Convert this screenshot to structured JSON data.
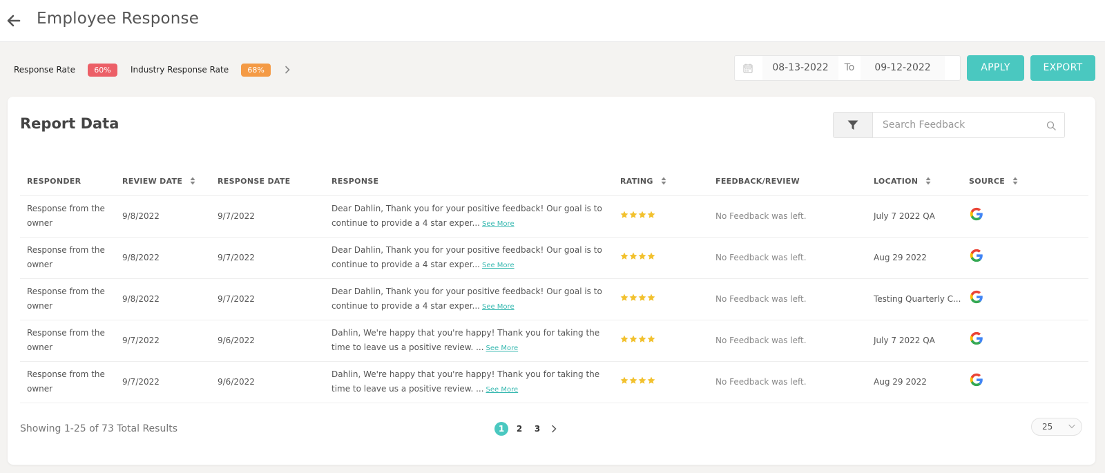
{
  "header": {
    "title": "Employee Response"
  },
  "rates": {
    "response_label": "Response Rate",
    "response_value": "60%",
    "industry_label": "Industry Response Rate",
    "industry_value": "68%"
  },
  "date_range": {
    "from": "08-13-2022",
    "to_label": "To",
    "to": "09-12-2022"
  },
  "actions": {
    "apply": "APPLY",
    "export": "EXPORT"
  },
  "report": {
    "title": "Report Data",
    "search_placeholder": "Search Feedback",
    "columns": [
      "RESPONDER",
      "REVIEW DATE",
      "RESPONSE DATE",
      "RESPONSE",
      "RATING",
      "FEEDBACK/REVIEW",
      "LOCATION",
      "SOURCE"
    ],
    "rows": [
      {
        "responder": "Response from the owner",
        "review_date": "9/8/2022",
        "response_date": "9/7/2022",
        "response": "Dear Dahlin, Thank you for your positive feedback! Our goal is to continue to provide a 4 star exper...",
        "see_more": "See More",
        "rating": 4,
        "feedback": "No Feedback was left.",
        "location": "July 7 2022 QA",
        "source": "google-icon"
      },
      {
        "responder": "Response from the owner",
        "review_date": "9/8/2022",
        "response_date": "9/7/2022",
        "response": "Dear Dahlin, Thank you for your positive feedback! Our goal is to continue to provide a 4 star exper...",
        "see_more": "See More",
        "rating": 4,
        "feedback": "No Feedback was left.",
        "location": "Aug 29 2022",
        "source": "google-icon"
      },
      {
        "responder": "Response from the owner",
        "review_date": "9/8/2022",
        "response_date": "9/7/2022",
        "response": "Dear Dahlin, Thank you for your positive feedback! Our goal is to continue to provide a 4 star exper...",
        "see_more": "See More",
        "rating": 4,
        "feedback": "No Feedback was left.",
        "location": "Testing Quarterly C...",
        "source": "google-icon"
      },
      {
        "responder": "Response from the owner",
        "review_date": "9/7/2022",
        "response_date": "9/6/2022",
        "response": "Dahlin, We're happy that you're happy! Thank you for taking the time to leave us a positive review. ...",
        "see_more": "See More",
        "rating": 4,
        "feedback": "No Feedback was left.",
        "location": "July 7 2022 QA",
        "source": "google-icon"
      },
      {
        "responder": "Response from the owner",
        "review_date": "9/7/2022",
        "response_date": "9/6/2022",
        "response": "Dahlin, We're happy that you're happy! Thank you for taking the time to leave us a positive review. ...",
        "see_more": "See More",
        "rating": 4,
        "feedback": "No Feedback was left.",
        "location": "Aug 29 2022",
        "source": "google-icon"
      }
    ]
  },
  "footer": {
    "showing": "Showing 1-25 of 73 Total Results",
    "pages": [
      "1",
      "2",
      "3"
    ],
    "active_page": "1",
    "per_page": "25"
  },
  "colors": {
    "accent": "#4ac8c0",
    "response_badge": "#ec5f67",
    "industry_badge": "#f49a45",
    "star": "#f2c12e"
  }
}
